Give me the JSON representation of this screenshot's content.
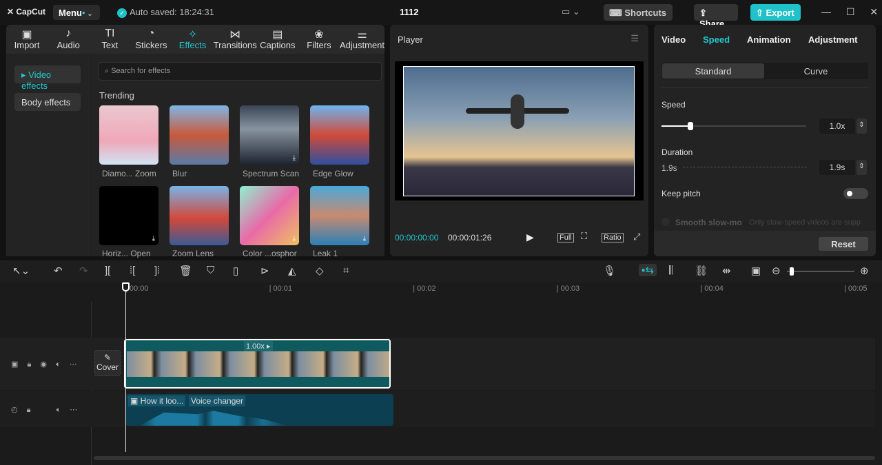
{
  "app": {
    "logo": "CapCut",
    "menu": "Menu",
    "auto_saved": "Auto saved: 18:24:31",
    "project_title": "1112",
    "shortcuts": "Shortcuts",
    "share": "Share",
    "export": "Export"
  },
  "tabs": [
    {
      "label": "Import",
      "icon": "▣"
    },
    {
      "label": "Audio",
      "icon": "♪"
    },
    {
      "label": "Text",
      "icon": "TI"
    },
    {
      "label": "Stickers",
      "icon": "◔"
    },
    {
      "label": "Effects",
      "icon": "✧"
    },
    {
      "label": "Transitions",
      "icon": "⋈"
    },
    {
      "label": "Captions",
      "icon": "▤"
    },
    {
      "label": "Filters",
      "icon": "❀"
    },
    {
      "label": "Adjustment",
      "icon": "⚌"
    }
  ],
  "sidebar": {
    "video_effects": "▸ Video effects",
    "body_effects": "Body effects"
  },
  "effects": {
    "search_placeholder": "Search for effects",
    "section": "Trending",
    "items": [
      {
        "label": "Diamo... Zoom"
      },
      {
        "label": "Blur"
      },
      {
        "label": "Spectrum Scan"
      },
      {
        "label": "Edge Glow"
      },
      {
        "label": "Horiz... Open"
      },
      {
        "label": "Zoom Lens"
      },
      {
        "label": "Color ...osphor"
      },
      {
        "label": "Leak 1"
      }
    ]
  },
  "player": {
    "title": "Player",
    "current_time": "00:00:00:00",
    "total_time": "00:00:01:26",
    "full": "Full",
    "ratio": "Ratio"
  },
  "right": {
    "tabs": [
      "Video",
      "Speed",
      "Animation",
      "Adjustment"
    ],
    "active_tab": "Speed",
    "modes": [
      "Standard",
      "Curve"
    ],
    "speed_label": "Speed",
    "speed_value": "1.0x",
    "speed_fraction": 0.2,
    "duration_label": "Duration",
    "duration_from": "1.9s",
    "duration_value": "1.9s",
    "keep_pitch": "Keep pitch",
    "keep_pitch_on": false,
    "smooth": "Smooth slow-mo",
    "smooth_note": "Only slow-speed videos are supp",
    "reset": "Reset"
  },
  "timeline": {
    "ticks": [
      "00:00",
      "00:01",
      "00:02",
      "00:03",
      "00:04",
      "00:05"
    ],
    "clip_speed": "1.00x ▸",
    "cover": "Cover",
    "audio_labels": [
      "How it loo...",
      "Voice changer"
    ]
  },
  "colors": {
    "accent": "#22c7d0",
    "clip": "#0e5a5e",
    "audio": "#0c3f52"
  }
}
